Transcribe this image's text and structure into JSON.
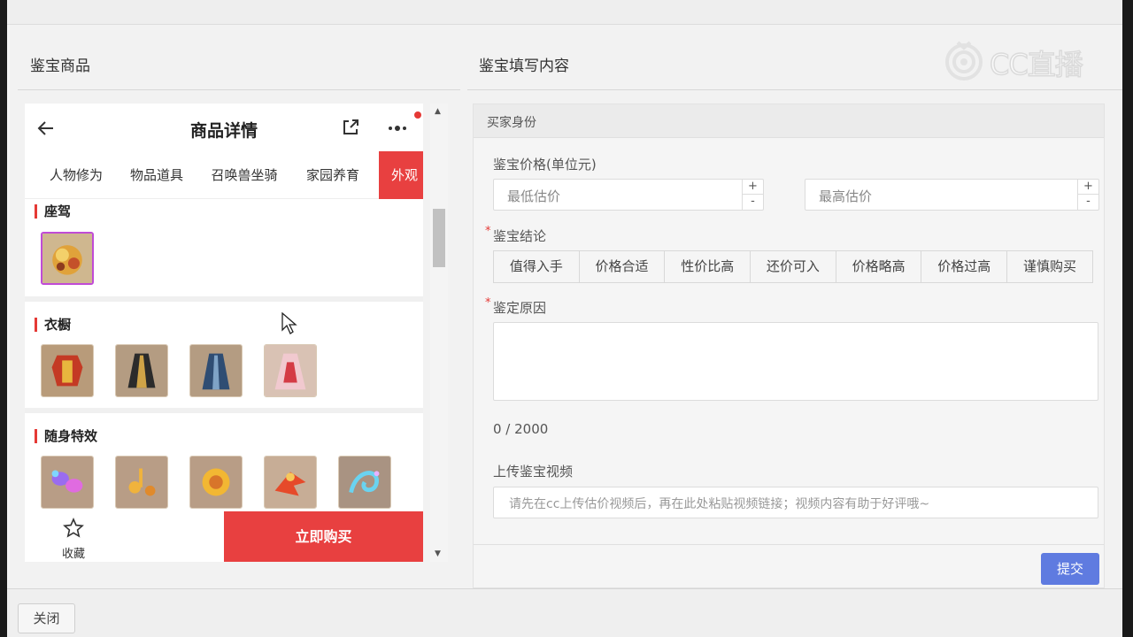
{
  "left_panel": {
    "title": "鉴宝商品"
  },
  "right_panel": {
    "title": "鉴宝填写内容"
  },
  "watermark": {
    "text": "CC直播"
  },
  "phone": {
    "title": "商品详情",
    "tabs": [
      {
        "label": "人物修为",
        "active": false
      },
      {
        "label": "物品道具",
        "active": false
      },
      {
        "label": "召唤兽坐骑",
        "active": false
      },
      {
        "label": "家园养育",
        "active": false
      },
      {
        "label": "外观",
        "active": true
      }
    ],
    "sections": [
      {
        "title": "座驾",
        "items": [
          "mount-golden-lion"
        ]
      },
      {
        "title": "衣橱",
        "items": [
          "outfit-red-armor",
          "outfit-black-gold-robe",
          "outfit-blue-robe",
          "outfit-pink-dress"
        ]
      },
      {
        "title": "随身特效",
        "items": [
          "effect-butterfly",
          "effect-music-notes",
          "effect-golden-flower",
          "effect-fire-bird",
          "effect-blue-swirl"
        ]
      }
    ],
    "footer": {
      "favorite_label": "收藏",
      "buy_label": "立即购买"
    }
  },
  "form": {
    "section_header": "买家身份",
    "price": {
      "label": "鉴宝价格(单位元)",
      "min_placeholder": "最低估价",
      "max_placeholder": "最高估价",
      "plus": "+",
      "minus": "-"
    },
    "conclusion": {
      "label": "鉴宝结论",
      "options": [
        "值得入手",
        "价格合适",
        "性价比高",
        "还价可入",
        "价格略高",
        "价格过高",
        "谨慎购买"
      ]
    },
    "reason": {
      "label": "鉴定原因",
      "counter": "0 / 2000"
    },
    "video": {
      "label": "上传鉴宝视频",
      "placeholder": "请先在cc上传估价视频后，再在此处粘贴视频链接；视频内容有助于好评哦~"
    },
    "submit_label": "提交"
  },
  "bottom": {
    "close_label": "关闭"
  },
  "colors": {
    "accent_red": "#e84040",
    "submit_blue": "#5f7be0",
    "selected_border": "#c04bd6"
  }
}
